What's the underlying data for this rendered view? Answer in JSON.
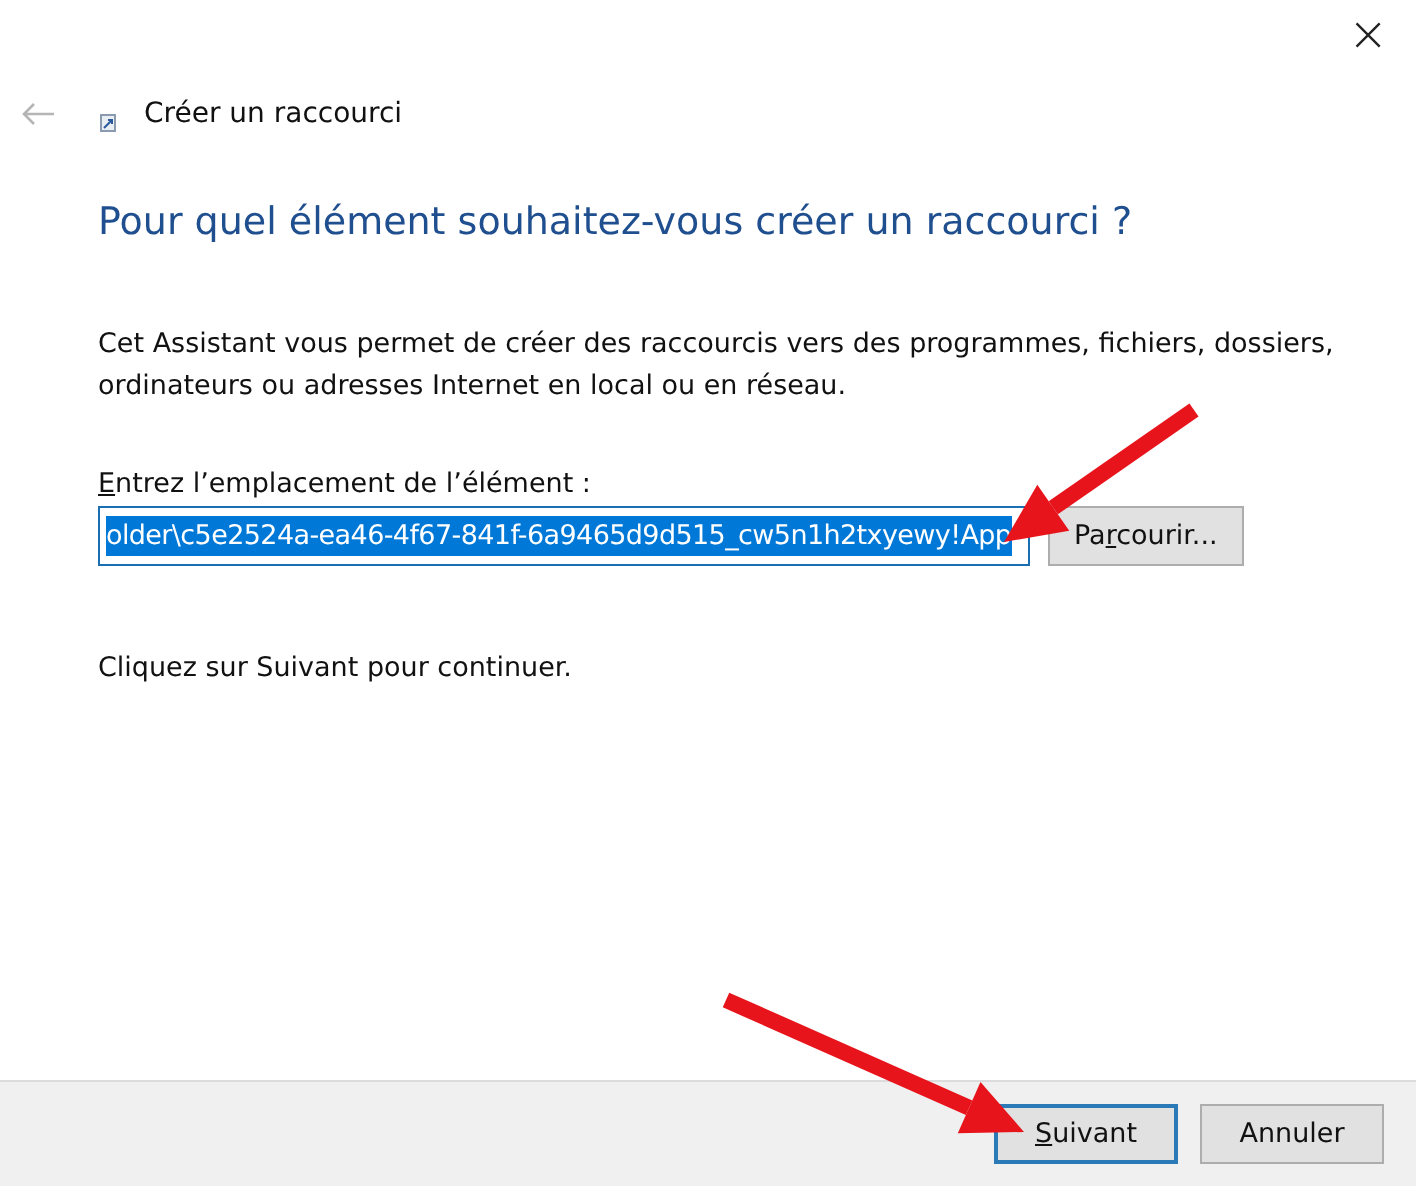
{
  "window": {
    "close": "×"
  },
  "header": {
    "title": "Créer un raccourci"
  },
  "heading": "Pour quel élément souhaitez-vous créer un raccourci ?",
  "description": "Cet Assistant vous permet de créer des raccourcis vers des programmes, fichiers, dossiers, ordinateurs ou adresses Internet en local ou en réseau.",
  "location": {
    "label": {
      "key": "E",
      "after": "ntrez l’emplacement de l’élément :"
    },
    "value": "older\\c5e2524a-ea46-4f67-841f-6a9465d9d515_cw5n1h2txyewy!App",
    "selected": true,
    "browse": {
      "before": "Pa",
      "key": "r",
      "after": "courir..."
    }
  },
  "hint": "Cliquez sur Suivant pour continuer.",
  "buttons": [
    {
      "key": "S",
      "after": "uivant",
      "default": true
    },
    {
      "before": "Annuler",
      "default": false
    }
  ],
  "annotations": [
    {
      "kind": "arrow"
    },
    {
      "kind": "arrow"
    }
  ]
}
